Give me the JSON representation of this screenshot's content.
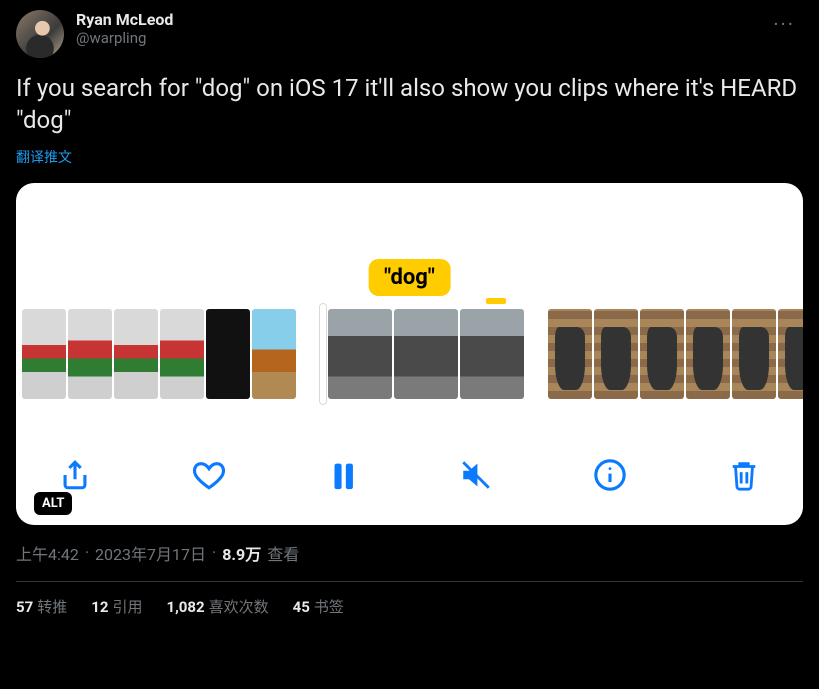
{
  "author": {
    "display_name": "Ryan McLeod",
    "handle": "@warpling"
  },
  "more_label": "···",
  "tweet_text": "If you search for \"dog\" on iOS 17 it'll also show you clips where it's HEARD \"dog\"",
  "translate_label": "翻译推文",
  "media": {
    "caption_text": "\"dog\"",
    "alt_badge": "ALT",
    "icons": {
      "share": "share-icon",
      "heart": "heart-icon",
      "pause": "pause-icon",
      "mute": "speaker-muted-icon",
      "info": "info-icon",
      "trash": "trash-icon"
    }
  },
  "meta": {
    "time": "上午4:42",
    "dot1": "·",
    "date": "2023年7月17日",
    "dot2": "·",
    "views_count": "8.9万",
    "views_label": "查看"
  },
  "stats": {
    "retweets": {
      "count": "57",
      "label": "转推"
    },
    "quotes": {
      "count": "12",
      "label": "引用"
    },
    "likes": {
      "count": "1,082",
      "label": "喜欢次数"
    },
    "bookmarks": {
      "count": "45",
      "label": "书签"
    }
  }
}
